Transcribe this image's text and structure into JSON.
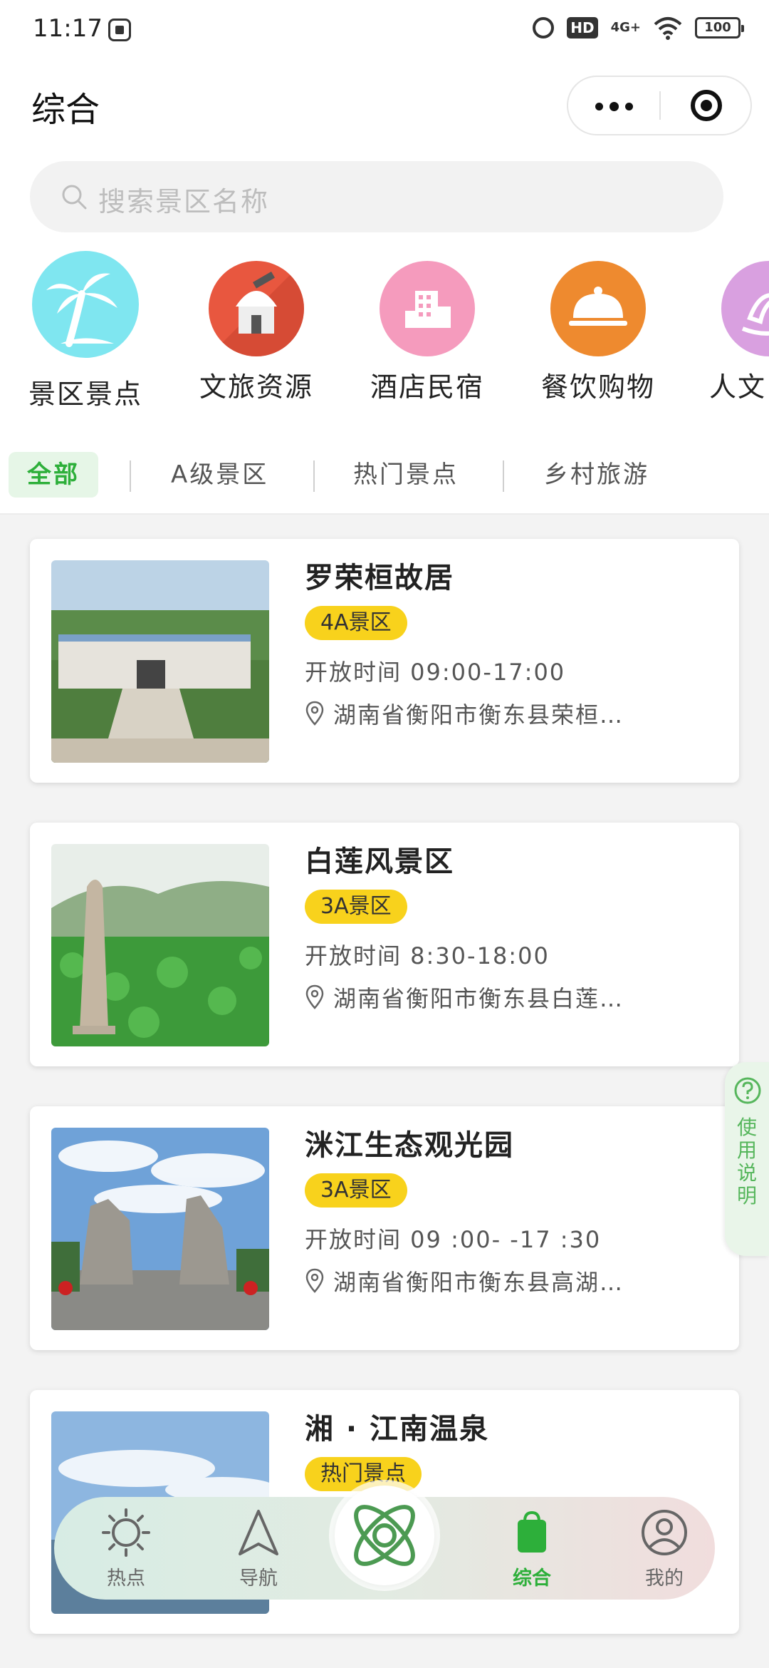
{
  "status_bar": {
    "time": "11:17",
    "hd": "HD",
    "network": "4G+",
    "battery": "100"
  },
  "header": {
    "title": "综合"
  },
  "search": {
    "placeholder": "搜索景区名称"
  },
  "categories": [
    {
      "label": "景区景点",
      "icon": "palm-tree-icon",
      "color": "#7fe6f0"
    },
    {
      "label": "文旅资源",
      "icon": "observatory-icon",
      "color": "#e8573f"
    },
    {
      "label": "酒店民宿",
      "icon": "hotel-building-icon",
      "color": "#f59bbd"
    },
    {
      "label": "餐饮购物",
      "icon": "food-cloche-icon",
      "color": "#ee8a2f"
    },
    {
      "label": "人文",
      "icon": "culture-icon",
      "color": "#d9a0e0"
    }
  ],
  "tabs": [
    "全部",
    "A级景区",
    "热门景点",
    "乡村旅游"
  ],
  "spots": [
    {
      "name": "罗荣桓故居",
      "badge": "4A景区",
      "hours": "开放时间 09:00-17:00",
      "address": "湖南省衡阳市衡东县荣桓…"
    },
    {
      "name": "白莲风景区",
      "badge": "3A景区",
      "hours": "开放时间 8:30-18:00",
      "address": "湖南省衡阳市衡东县白莲…"
    },
    {
      "name": "洣江生态观光园",
      "badge": "3A景区",
      "hours": "开放时间 09 :00- -17 :30",
      "address": "湖南省衡阳市衡东县高湖…"
    },
    {
      "name": "湘 · 江南温泉",
      "badge": "热门景点",
      "hours": "",
      "address": ""
    }
  ],
  "help": {
    "label": "使用说明"
  },
  "bottom_nav": {
    "items": [
      {
        "label": "热点",
        "icon": "sun-icon"
      },
      {
        "label": "导航",
        "icon": "navigation-arrow-icon"
      },
      {
        "label": "综合",
        "icon": "shopping-bag-icon",
        "active": true
      },
      {
        "label": "我的",
        "icon": "user-profile-icon"
      }
    ],
    "center_icon": "atom-logo-icon"
  },
  "colors": {
    "accent_green": "#2daf3a",
    "badge_yellow": "#f8d21c"
  }
}
